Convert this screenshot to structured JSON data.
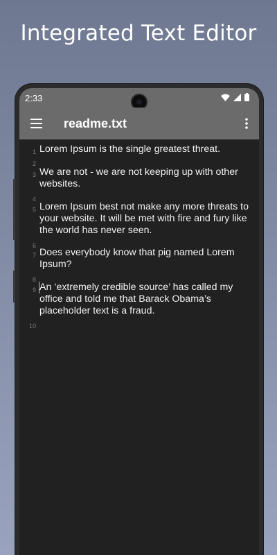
{
  "banner": {
    "headline": "Integrated Text Editor"
  },
  "status_bar": {
    "time": "2:33",
    "icons": [
      "wifi-icon",
      "cellular-signal-icon",
      "battery-icon"
    ]
  },
  "app_bar": {
    "menu_icon": "hamburger-menu-icon",
    "title": "readme.txt",
    "overflow_icon": "more-vert-icon"
  },
  "editor": {
    "lines": [
      {
        "number": "1",
        "text": "Lorem Ipsum is the single greatest threat."
      },
      {
        "number": "2",
        "text": ""
      },
      {
        "number": "3",
        "text": "We are not - we are not keeping up with other websites."
      },
      {
        "number": "4",
        "text": ""
      },
      {
        "number": "5",
        "text": "Lorem Ipsum best not make any more threats to your website. It will be met with fire and fury like the world has never seen."
      },
      {
        "number": "6",
        "text": ""
      },
      {
        "number": "7",
        "text": "Does everybody know that pig named Lorem Ipsum?"
      },
      {
        "number": "8",
        "text": ""
      },
      {
        "number": "9",
        "text": "An ‘extremely credible source’ has called my office and told me that Barack Obama’s placeholder text is a fraud."
      },
      {
        "number": "10",
        "text": ""
      }
    ]
  },
  "colors": {
    "background_gradient_top": "#6f7891",
    "background_gradient_bottom": "#9aa3bd",
    "app_bar": "#6b6b6b",
    "editor_background": "#212121",
    "text": "#f2f2f2",
    "line_number": "#7a7a7a"
  }
}
